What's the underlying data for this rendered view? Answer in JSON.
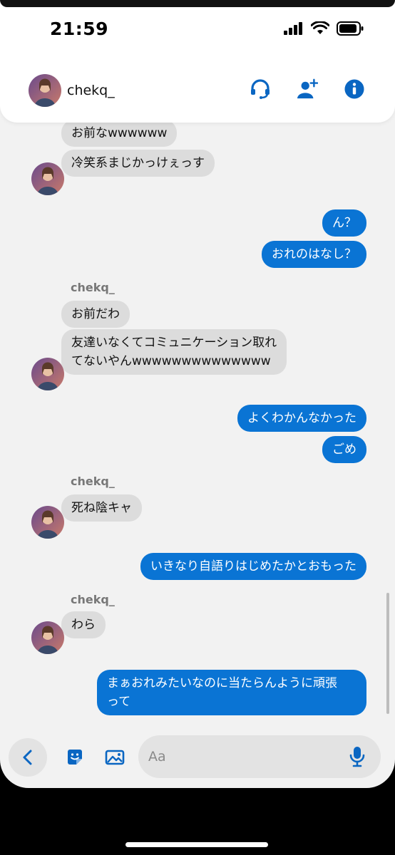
{
  "status": {
    "time": "21:59"
  },
  "header": {
    "contact_name": "chekq_",
    "icons": [
      "headset-icon",
      "add-person-icon",
      "info-icon"
    ]
  },
  "messages": {
    "m1": {
      "text": "お前なwwwwww"
    },
    "m2": {
      "text": "冷笑系まじかっけぇっす"
    },
    "m3": {
      "text": "ん？"
    },
    "m4": {
      "text": "おれのはなし？"
    },
    "sender1": "chekq_",
    "m5": {
      "text": "お前だわ"
    },
    "m6": {
      "line1": "友達いなくてコミュニケーション取れ",
      "line2": "てないやんwwwwwwwwwwwwww"
    },
    "m7": {
      "text": "よくわかんなかった"
    },
    "m8": {
      "text": "ごめ"
    },
    "sender2": "chekq_",
    "m9": {
      "text": "死ね陰キャ"
    },
    "m10": {
      "text": "いきなり自語りはじめたかとおもった"
    },
    "sender3": "chekq_",
    "m11": {
      "text": "わら"
    },
    "m12": {
      "line1": "まぁおれみたいなのに当たらんように頑張",
      "line2": "って"
    }
  },
  "composer": {
    "placeholder": "Aa"
  },
  "colors": {
    "outgoing_bubble": "#0a74d4",
    "incoming_bubble": "#dcdcdc",
    "accent": "#0a66c2"
  }
}
